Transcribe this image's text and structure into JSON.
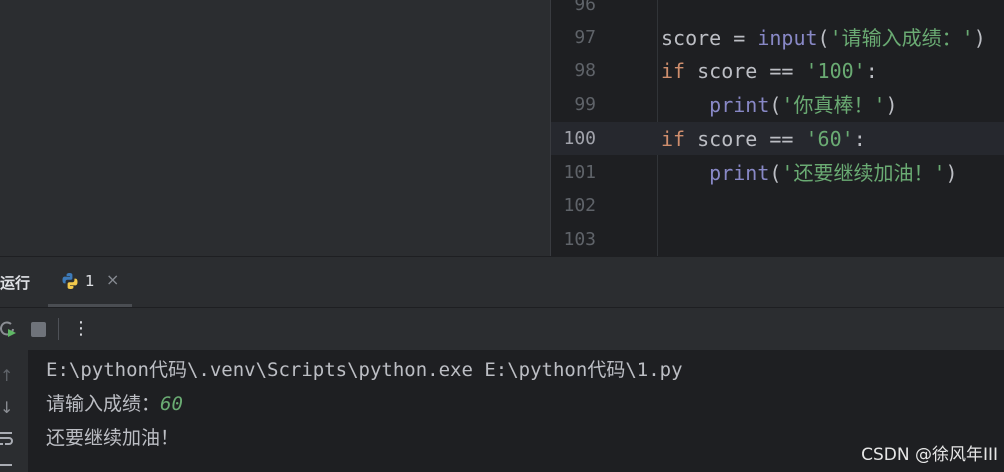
{
  "editor": {
    "lines": [
      {
        "num": "96",
        "tokens": []
      },
      {
        "num": "97",
        "tokens": [
          {
            "text": "score = ",
            "cls": "p"
          },
          {
            "text": "input",
            "cls": "fn"
          },
          {
            "text": "(",
            "cls": "p"
          },
          {
            "text": "'请输入成绩：'",
            "cls": "str"
          },
          {
            "text": ")",
            "cls": "p"
          }
        ]
      },
      {
        "num": "98",
        "tokens": [
          {
            "text": "if",
            "cls": "kw"
          },
          {
            "text": " score == ",
            "cls": "p"
          },
          {
            "text": "'100'",
            "cls": "str"
          },
          {
            "text": ":",
            "cls": "p"
          }
        ]
      },
      {
        "num": "99",
        "tokens": [
          {
            "text": "    print",
            "cls": "fn"
          },
          {
            "text": "(",
            "cls": "p"
          },
          {
            "text": "'你真棒！'",
            "cls": "str"
          },
          {
            "text": ")",
            "cls": "p"
          }
        ]
      },
      {
        "num": "100",
        "tokens": [
          {
            "text": "if",
            "cls": "kw"
          },
          {
            "text": " score == ",
            "cls": "p"
          },
          {
            "text": "'60'",
            "cls": "str"
          },
          {
            "text": ":",
            "cls": "p"
          }
        ]
      },
      {
        "num": "101",
        "tokens": [
          {
            "text": "    print",
            "cls": "fn"
          },
          {
            "text": "(",
            "cls": "p"
          },
          {
            "text": "'还要继续加油！'",
            "cls": "str"
          },
          {
            "text": ")",
            "cls": "p"
          }
        ]
      },
      {
        "num": "102",
        "tokens": []
      },
      {
        "num": "103",
        "tokens": []
      }
    ],
    "current_line": "100"
  },
  "run_panel": {
    "title": "运行",
    "tab": {
      "label": "1",
      "icon": "python-icon",
      "close": "×"
    },
    "toolbar": {
      "rerun": "rerun-icon",
      "stop": "stop-icon",
      "more": "⋮"
    },
    "side": {
      "up": "↑",
      "down": "↓"
    },
    "output": {
      "command": "E:\\python代码\\.venv\\Scripts\\python.exe E:\\python代码\\1.py",
      "prompt": "请输入成绩：",
      "input_value": "60",
      "result": "还要继续加油！"
    }
  },
  "watermark": "CSDN @徐风年III",
  "colors": {
    "keyword": "#cf8e6d",
    "builtin": "#8888c6",
    "string": "#6aab73",
    "text": "#bcbec4",
    "background": "#1e1f22",
    "panel": "#2b2d30"
  }
}
